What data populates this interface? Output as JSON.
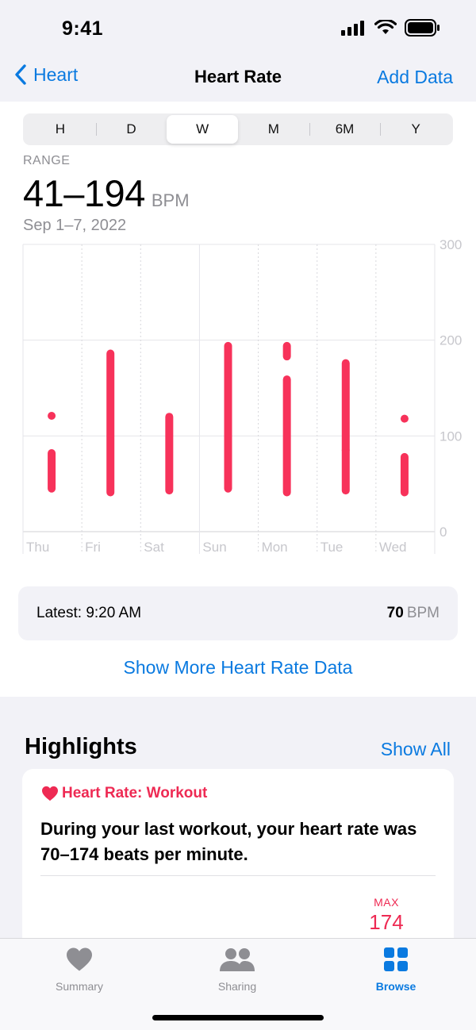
{
  "status": {
    "time": "9:41"
  },
  "nav": {
    "back_label": "Heart",
    "title": "Heart Rate",
    "action_label": "Add Data"
  },
  "segments": [
    {
      "label": "H",
      "active": false
    },
    {
      "label": "D",
      "active": false
    },
    {
      "label": "W",
      "active": true
    },
    {
      "label": "M",
      "active": false
    },
    {
      "label": "6M",
      "active": false
    },
    {
      "label": "Y",
      "active": false
    }
  ],
  "summary": {
    "range_label": "RANGE",
    "range_value": "41–194",
    "unit": "BPM",
    "date_range": "Sep 1–7, 2022"
  },
  "chart_data": {
    "type": "range-bar",
    "categories": [
      "Thu",
      "Fri",
      "Sat",
      "Sun",
      "Mon",
      "Tue",
      "Wed"
    ],
    "ylim": [
      0,
      300
    ],
    "yticks": [
      "300",
      "200",
      "100",
      "0"
    ],
    "ytick_values": [
      300,
      200,
      100,
      0
    ],
    "grid": true,
    "color": "#f7325a",
    "ranges": [
      [
        [
          121,
          121
        ],
        [
          45,
          82
        ]
      ],
      [
        [
          41,
          186
        ]
      ],
      [
        [
          43,
          120
        ]
      ],
      [
        [
          45,
          194
        ]
      ],
      [
        [
          183,
          194
        ],
        [
          41,
          159
        ]
      ],
      [
        [
          85,
          176
        ],
        [
          43,
          85
        ]
      ],
      [
        [
          118,
          118
        ],
        [
          41,
          78
        ]
      ]
    ]
  },
  "latest": {
    "label": "Latest: 9:20 AM",
    "value": "70",
    "unit": "BPM"
  },
  "more_link": "Show More Heart Rate Data",
  "highlights": {
    "title": "Highlights",
    "show_all": "Show All",
    "card": {
      "header": "Heart Rate: Workout",
      "body": "During your last workout, your heart rate was 70–174 beats per minute.",
      "max_label": "MAX",
      "max_value": "174"
    }
  },
  "tabbar": [
    {
      "label": "Summary",
      "icon": "heart-icon",
      "active": false
    },
    {
      "label": "Sharing",
      "icon": "people-icon",
      "active": false
    },
    {
      "label": "Browse",
      "icon": "grid-icon",
      "active": true
    }
  ],
  "colors": {
    "accent": "#0a7ae0",
    "heart": "#f7325a",
    "secondary": "#8e8e93"
  }
}
